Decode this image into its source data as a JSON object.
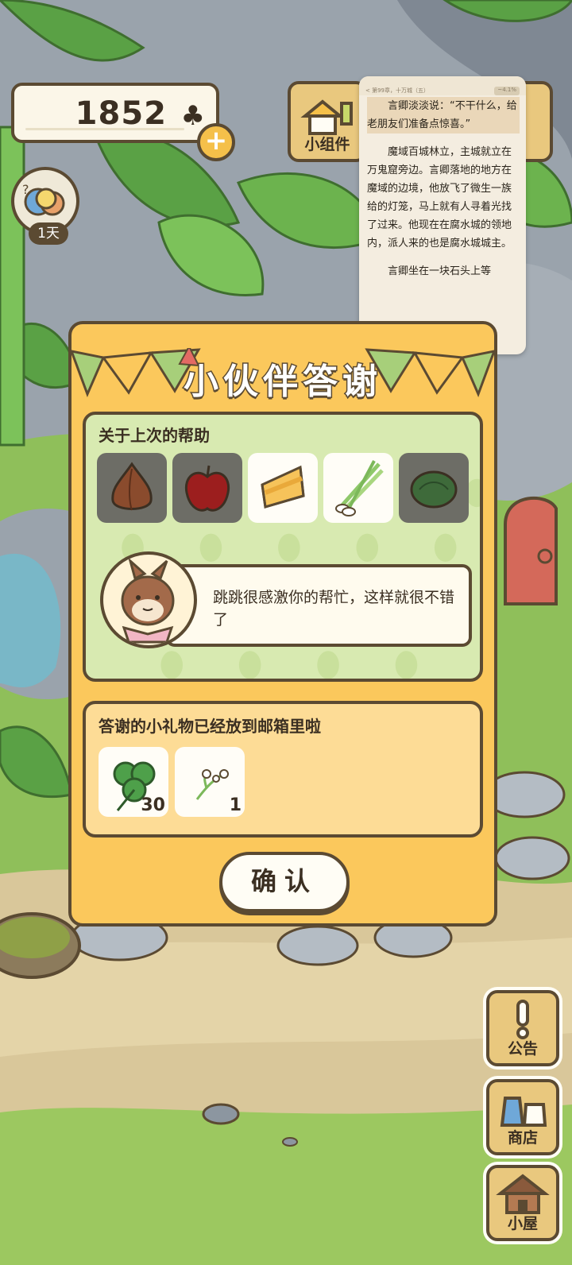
{
  "clovers": {
    "count": "1852",
    "icon": "clover-icon"
  },
  "travel": {
    "days_label": "1天"
  },
  "widget": {
    "label": "小组件"
  },
  "reader": {
    "chapter": "< 第99章，十万城（五）",
    "chip": "~4.1%",
    "paragraphs": [
      "言卿淡淡说：“不干什么，给老朋友们准备点惊喜。”",
      "魔域百城林立，主城就立在万鬼窟旁边。言卿落地的地方在魔域的边境，他放飞了微生一族给的灯笼，马上就有人寻着光找了过来。他现在在腐水城的领地内，派人来的也是腐水城城主。",
      "言卿坐在一块石头上等"
    ]
  },
  "dialog": {
    "title": "小伙伴答谢",
    "help_heading": "关于上次的帮助",
    "items": [
      {
        "name": "onion",
        "state": "locked"
      },
      {
        "name": "apple",
        "state": "locked"
      },
      {
        "name": "cheese",
        "state": "open"
      },
      {
        "name": "green-onion",
        "state": "open"
      },
      {
        "name": "cabbage",
        "state": "locked"
      }
    ],
    "message": "跳跳很感激你的帮忙，这样就很不错了",
    "gift_heading": "答谢的小礼物已经放到邮箱里啦",
    "gifts": [
      {
        "name": "clover",
        "qty": "30"
      },
      {
        "name": "flower-sprig",
        "qty": "1"
      }
    ],
    "confirm_label": "确认"
  },
  "menu": {
    "notice_label": "公告",
    "shop_label": "商店",
    "house_label": "小屋"
  },
  "colors": {
    "dialog_bg": "#fbc85c",
    "outline": "#5b4a32",
    "help_bg": "#d8eab1",
    "gift_bg": "#fddc96",
    "menu_bg": "#e9c87e"
  }
}
